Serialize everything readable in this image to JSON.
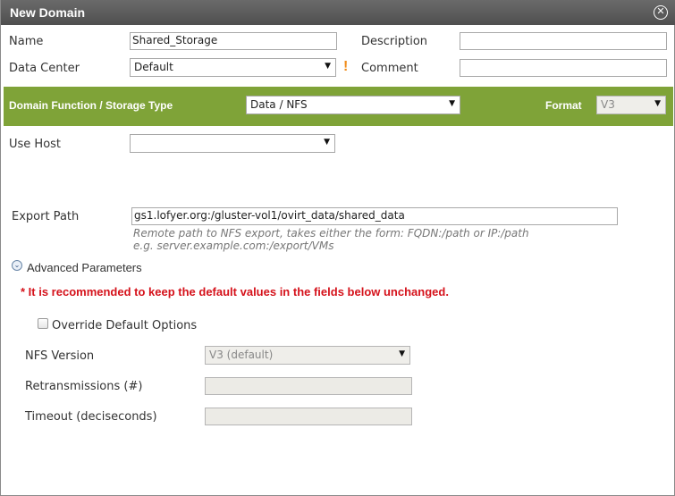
{
  "dialog": {
    "title": "New Domain",
    "close_glyph": "✕"
  },
  "form": {
    "name_label": "Name",
    "name_value": "Shared_Storage",
    "description_label": "Description",
    "description_value": "",
    "data_center_label": "Data Center",
    "data_center_value": "Default",
    "comment_label": "Comment",
    "comment_value": "",
    "warning_glyph": "!",
    "domain_function_label": "Domain Function / Storage Type",
    "domain_function_value": "Data / NFS",
    "format_label": "Format",
    "format_value": "V3",
    "use_host_label": "Use Host",
    "use_host_value": "",
    "export_path_label": "Export Path",
    "export_path_value": "gs1.lofyer.org:/gluster-vol1/ovirt_data/shared_data",
    "export_hint_1": "Remote path to NFS export, takes either the form: FQDN:/path or IP:/path",
    "export_hint_2": "e.g. server.example.com:/export/VMs"
  },
  "advanced": {
    "toggle_glyph": "⌄",
    "label": "Advanced Parameters",
    "recommendation": "* It is recommended to keep the default values in the fields below unchanged.",
    "override_label": "Override Default Options",
    "override_checked": false,
    "nfs_version_label": "NFS Version",
    "nfs_version_value": "V3 (default)",
    "retransmissions_label": "Retransmissions (#)",
    "retransmissions_value": "",
    "timeout_label": "Timeout (deciseconds)",
    "timeout_value": ""
  },
  "colors": {
    "title_bar": "#5a5a5a",
    "function_bar": "#7fa338",
    "warning": "#f08c1a",
    "recommendation": "#d5121b"
  },
  "icons": {
    "close": "close-icon",
    "warning": "warning-icon",
    "dropdown": "chevron-down-icon",
    "expand": "expand-icon"
  }
}
